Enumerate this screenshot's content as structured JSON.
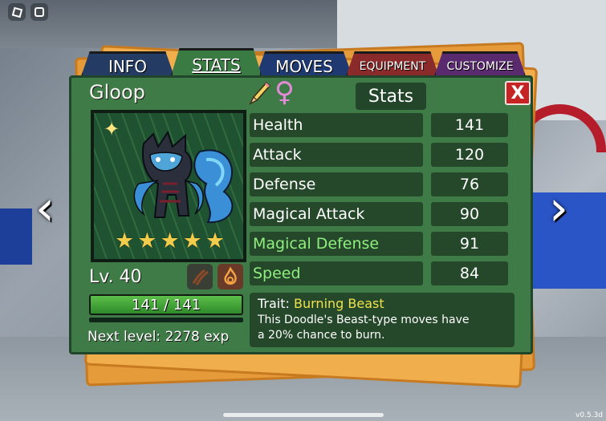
{
  "tabs": [
    {
      "label": "INFO"
    },
    {
      "label": "STATS"
    },
    {
      "label": "MOVES"
    },
    {
      "label": "EQUIPMENT"
    },
    {
      "label": "CUSTOMIZE"
    }
  ],
  "active_tab": "STATS",
  "doodle": {
    "name": "Gloop",
    "gender_icon": "female-icon",
    "level": "Lv. 40",
    "stars": 5,
    "types": [
      "beast-type-icon",
      "fire-type-icon"
    ],
    "hp_text": "141 / 141",
    "hp_fraction": 1.0,
    "next_level": "Next level: 2278 exp"
  },
  "stats_panel": {
    "header": "Stats",
    "close_label": "X",
    "rows": [
      {
        "label": "Health",
        "value": "141",
        "highlight": false
      },
      {
        "label": "Attack",
        "value": "120",
        "highlight": false
      },
      {
        "label": "Defense",
        "value": "76",
        "highlight": false
      },
      {
        "label": "Magical Attack",
        "value": "90",
        "highlight": false
      },
      {
        "label": "Magical Defense",
        "value": "91",
        "highlight": true
      },
      {
        "label": "Speed",
        "value": "84",
        "highlight": true
      }
    ]
  },
  "trait": {
    "prefix": "Trait:",
    "name": "Burning Beast",
    "description_1": "This Doodle's Beast-type moves have",
    "description_2": "a 20% chance to burn."
  },
  "nav": {
    "prev": "‹",
    "next": "›"
  },
  "version": "v0.5.3d",
  "colors": {
    "panel": "#3f7b46",
    "stat_box": "#25482b",
    "highlight_text": "#8fef7e",
    "trait_name": "#f0e24b",
    "close": "#c62424",
    "star": "#f2cc4b"
  }
}
